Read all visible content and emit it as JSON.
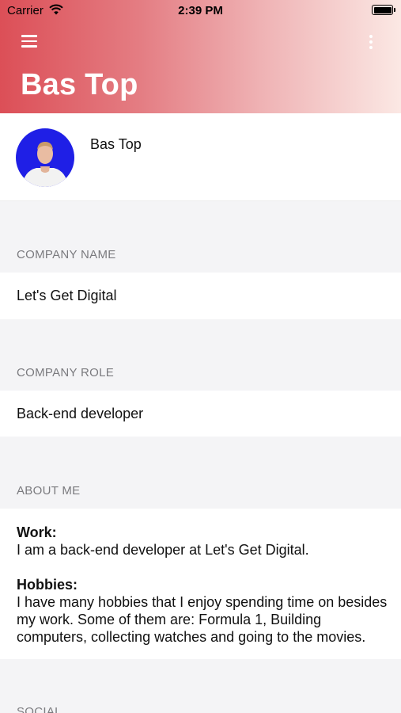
{
  "status_bar": {
    "carrier": "Carrier",
    "time": "2:39 PM"
  },
  "header": {
    "title": "Bas Top",
    "menu_icon": "hamburger-menu-icon",
    "more_icon": "vertical-dots-icon",
    "gradient_colors": [
      "#dc4f57",
      "#fbe8e4"
    ]
  },
  "profile": {
    "name": "Bas Top",
    "avatar_background": "#1f1fe6"
  },
  "sections": {
    "company_name": {
      "title": "COMPANY NAME",
      "value": "Let's Get Digital"
    },
    "company_role": {
      "title": "COMPANY ROLE",
      "value": "Back-end developer"
    },
    "about_me": {
      "title": "ABOUT ME",
      "work_label": "Work:",
      "work_text": "I am a back-end developer at Let's Get Digital.",
      "hobbies_label": "Hobbies:",
      "hobbies_text": "I have many hobbies that I enjoy spending time on besides my work. Some of them are: Formula 1, Building computers, collecting watches and going to the movies."
    },
    "social": {
      "title": "SOCIAL"
    }
  }
}
